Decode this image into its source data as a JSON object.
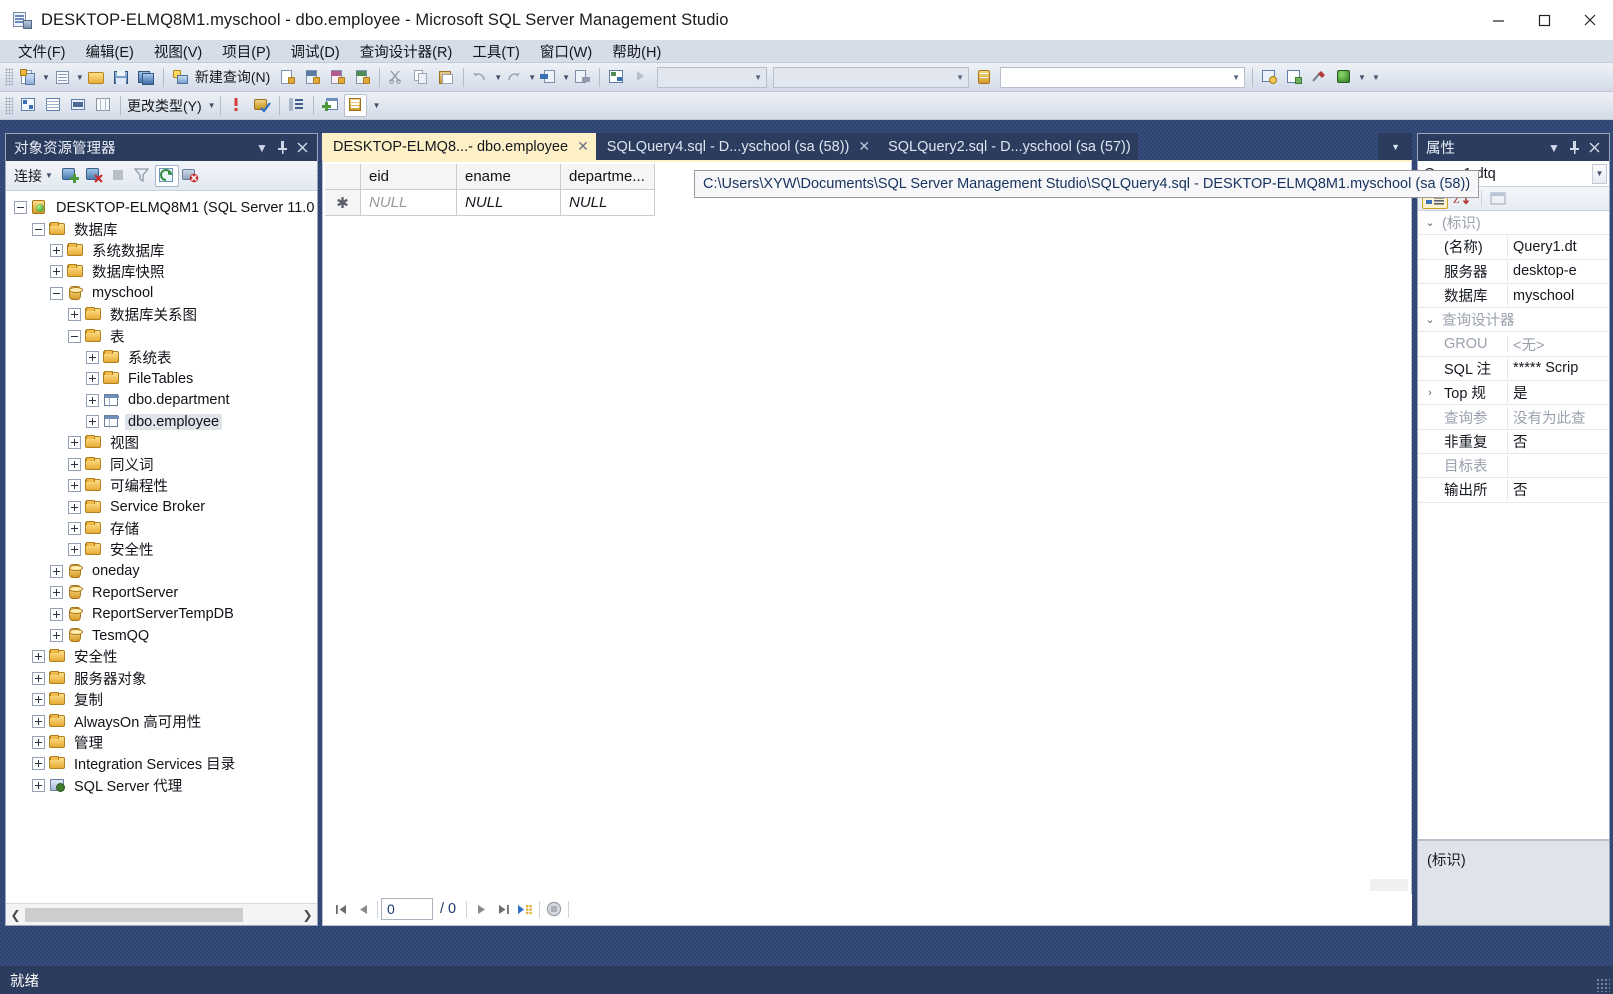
{
  "window": {
    "title": "DESKTOP-ELMQ8M1.myschool - dbo.employee - Microsoft SQL Server Management Studio",
    "app_icon": "sql-server-icon",
    "minimize": "─",
    "maximize": "□",
    "close": "✕"
  },
  "menu": [
    {
      "label": "文件(F)"
    },
    {
      "label": "编辑(E)"
    },
    {
      "label": "视图(V)"
    },
    {
      "label": "项目(P)"
    },
    {
      "label": "调试(D)"
    },
    {
      "label": "查询设计器(R)"
    },
    {
      "label": "工具(T)"
    },
    {
      "label": "窗口(W)"
    },
    {
      "label": "帮助(H)"
    }
  ],
  "toolbar_main": {
    "new_query_label": "新建查询(N)",
    "combo1_value": "",
    "combo2_value": "",
    "combo3_value": ""
  },
  "toolbar_designer": {
    "change_type_label": "更改类型(Y)"
  },
  "object_explorer": {
    "title": "对象资源管理器",
    "connect_label": "连接",
    "header_buttons": [
      "dropdown-icon",
      "pin-icon",
      "close-icon"
    ],
    "tree": [
      {
        "label": "DESKTOP-ELMQ8M1 (SQL Server 11.0",
        "indent": 0,
        "icon": "server-icon",
        "expander": "minus",
        "selected": false
      },
      {
        "label": "数据库",
        "indent": 1,
        "icon": "folder-icon",
        "expander": "minus",
        "selected": false
      },
      {
        "label": "系统数据库",
        "indent": 2,
        "icon": "folder-icon",
        "expander": "plus",
        "selected": false
      },
      {
        "label": "数据库快照",
        "indent": 2,
        "icon": "folder-icon",
        "expander": "plus",
        "selected": false
      },
      {
        "label": "myschool",
        "indent": 2,
        "icon": "database-icon",
        "expander": "minus",
        "selected": false
      },
      {
        "label": "数据库关系图",
        "indent": 3,
        "icon": "folder-icon",
        "expander": "plus",
        "selected": false
      },
      {
        "label": "表",
        "indent": 3,
        "icon": "folder-icon",
        "expander": "minus",
        "selected": false
      },
      {
        "label": "系统表",
        "indent": 4,
        "icon": "folder-icon",
        "expander": "plus",
        "selected": false
      },
      {
        "label": "FileTables",
        "indent": 4,
        "icon": "folder-icon",
        "expander": "plus",
        "selected": false
      },
      {
        "label": "dbo.department",
        "indent": 4,
        "icon": "table-icon",
        "expander": "plus",
        "selected": false
      },
      {
        "label": "dbo.employee",
        "indent": 4,
        "icon": "table-icon",
        "expander": "plus",
        "selected": true
      },
      {
        "label": "视图",
        "indent": 3,
        "icon": "folder-icon",
        "expander": "plus",
        "selected": false
      },
      {
        "label": "同义词",
        "indent": 3,
        "icon": "folder-icon",
        "expander": "plus",
        "selected": false
      },
      {
        "label": "可编程性",
        "indent": 3,
        "icon": "folder-icon",
        "expander": "plus",
        "selected": false
      },
      {
        "label": "Service Broker",
        "indent": 3,
        "icon": "folder-icon",
        "expander": "plus",
        "selected": false
      },
      {
        "label": "存储",
        "indent": 3,
        "icon": "folder-icon",
        "expander": "plus",
        "selected": false
      },
      {
        "label": "安全性",
        "indent": 3,
        "icon": "folder-icon",
        "expander": "plus",
        "selected": false
      },
      {
        "label": "oneday",
        "indent": 2,
        "icon": "database-icon",
        "expander": "plus",
        "selected": false
      },
      {
        "label": "ReportServer",
        "indent": 2,
        "icon": "database-icon",
        "expander": "plus",
        "selected": false
      },
      {
        "label": "ReportServerTempDB",
        "indent": 2,
        "icon": "database-icon",
        "expander": "plus",
        "selected": false
      },
      {
        "label": "TesmQQ",
        "indent": 2,
        "icon": "database-icon",
        "expander": "plus",
        "selected": false
      },
      {
        "label": "安全性",
        "indent": 1,
        "icon": "folder-icon",
        "expander": "plus",
        "selected": false
      },
      {
        "label": "服务器对象",
        "indent": 1,
        "icon": "folder-icon",
        "expander": "plus",
        "selected": false
      },
      {
        "label": "复制",
        "indent": 1,
        "icon": "folder-icon",
        "expander": "plus",
        "selected": false
      },
      {
        "label": "AlwaysOn 高可用性",
        "indent": 1,
        "icon": "folder-icon",
        "expander": "plus",
        "selected": false
      },
      {
        "label": "管理",
        "indent": 1,
        "icon": "folder-icon",
        "expander": "plus",
        "selected": false
      },
      {
        "label": "Integration Services 目录",
        "indent": 1,
        "icon": "folder-icon",
        "expander": "plus",
        "selected": false
      },
      {
        "label": "SQL Server 代理",
        "indent": 1,
        "icon": "agent-icon",
        "expander": "plus",
        "selected": false
      }
    ]
  },
  "tabs": [
    {
      "label": "DESKTOP-ELMQ8...- dbo.employee",
      "active": true,
      "close": "✕",
      "has_close": true
    },
    {
      "label": "SQLQuery4.sql - D...yschool (sa (58))",
      "active": false,
      "close": "✕",
      "has_close": true
    },
    {
      "label": "SQLQuery2.sql - D...yschool (sa (57))",
      "active": false,
      "close": "",
      "has_close": false
    }
  ],
  "tooltip": {
    "text": "C:\\Users\\XYW\\Documents\\SQL Server Management Studio\\SQLQuery4.sql - DESKTOP-ELMQ8M1.myschool (sa (58))"
  },
  "grid": {
    "row_marker": "✱",
    "columns": [
      "eid",
      "ename",
      "departme..."
    ],
    "rows": [
      {
        "marker": "✱",
        "cells": [
          "NULL",
          "NULL",
          "NULL"
        ]
      }
    ]
  },
  "grid_nav": {
    "first": "first-record-icon",
    "prev": "previous-record-icon",
    "current": "0",
    "separator": "/ 0",
    "next": "next-record-icon",
    "last": "last-record-icon",
    "new": "new-record-icon",
    "stop": "stop-icon"
  },
  "properties": {
    "title": "属性",
    "selected_object": "Query1.dtq",
    "view_buttons": [
      "categorized-icon",
      "alphabetical-icon",
      "property-pages-icon"
    ],
    "rows": [
      {
        "kind": "group",
        "expander": "⌄",
        "name": "(标识)",
        "value": ""
      },
      {
        "kind": "prop",
        "expander": "",
        "name": "(名称)",
        "value": "Query1.dt",
        "dim_name": false,
        "dim_value": false
      },
      {
        "kind": "prop",
        "expander": "",
        "name": "服务器",
        "value": "desktop-e",
        "dim_name": false,
        "dim_value": false
      },
      {
        "kind": "prop",
        "expander": "",
        "name": "数据库",
        "value": "myschool",
        "dim_name": false,
        "dim_value": false
      },
      {
        "kind": "group",
        "expander": "⌄",
        "name": "查询设计器",
        "value": ""
      },
      {
        "kind": "prop",
        "expander": "",
        "name": "GROU",
        "value": "<无>",
        "dim_name": true,
        "dim_value": true
      },
      {
        "kind": "prop",
        "expander": "",
        "name": "SQL 注",
        "value": "***** Scrip",
        "dim_name": false,
        "dim_value": false
      },
      {
        "kind": "prop",
        "expander": "›",
        "name": "Top 规",
        "value": "是",
        "dim_name": false,
        "dim_value": false
      },
      {
        "kind": "prop",
        "expander": "",
        "name": "查询参",
        "value": "没有为此查",
        "dim_name": true,
        "dim_value": true
      },
      {
        "kind": "prop",
        "expander": "",
        "name": "非重复",
        "value": "否",
        "dim_name": false,
        "dim_value": false
      },
      {
        "kind": "prop",
        "expander": "",
        "name": "目标表",
        "value": "",
        "dim_name": true,
        "dim_value": true
      },
      {
        "kind": "prop",
        "expander": "",
        "name": "输出所",
        "value": "否",
        "dim_name": false,
        "dim_value": false
      }
    ],
    "description_title": "(标识)"
  },
  "status_bar": {
    "text": "就绪"
  },
  "colors": {
    "chrome": "#2b3c5e",
    "active_tab": "#fdefc6",
    "toolbar": "#dee4ee",
    "menubar": "#d6dde8"
  }
}
